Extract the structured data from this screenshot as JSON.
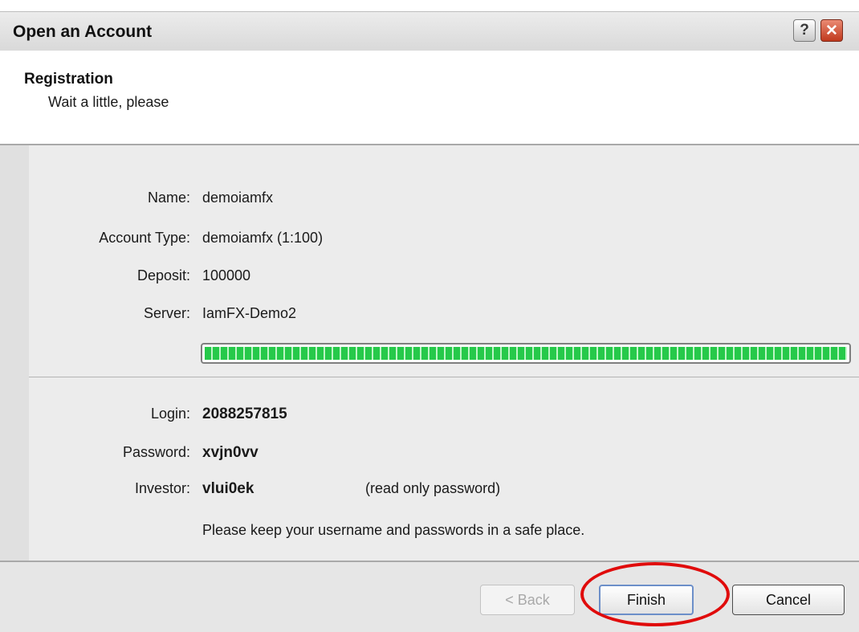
{
  "window": {
    "title": "Open an Account",
    "help_icon": "help-icon",
    "close_icon": "close-icon",
    "help_glyph": "?",
    "close_glyph": "✕"
  },
  "header": {
    "title": "Registration",
    "subtitle": "Wait a little, please"
  },
  "account": {
    "name_label": "Name:",
    "name_value": "demoiamfx",
    "type_label": "Account Type:",
    "type_value": "demoiamfx (1:100)",
    "deposit_label": "Deposit:",
    "deposit_value": "100000",
    "server_label": "Server:",
    "server_value": "IamFX-Demo2"
  },
  "progress": {
    "fraction": 1.0,
    "color": "#26c94a"
  },
  "credentials": {
    "login_label": "Login:",
    "login_value": "2088257815",
    "password_label": "Password:",
    "password_value": "xvjn0vv",
    "investor_label": "Investor:",
    "investor_value": "vlui0ek",
    "investor_note": "(read only password)",
    "notice": "Please keep your username and passwords in a safe place."
  },
  "buttons": {
    "back": "< Back",
    "finish": "Finish",
    "cancel": "Cancel"
  },
  "colors": {
    "highlight": "#e00b0b",
    "close_button": "#c0391d"
  }
}
